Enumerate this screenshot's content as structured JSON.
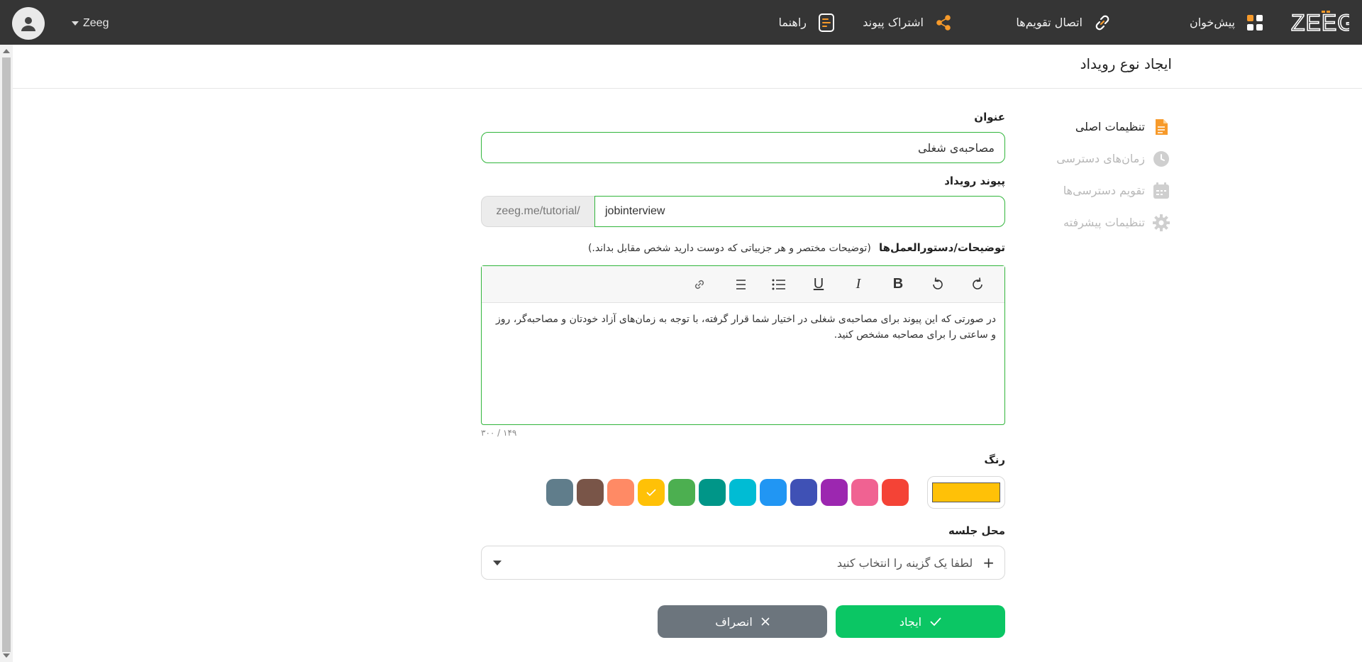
{
  "topbar": {
    "logo_text": "ZEEG",
    "nav": [
      {
        "label": "پیش‌خوان",
        "icon": "dashboard-grid-icon"
      },
      {
        "label": "اتصال تقویم‌ها",
        "icon": "link-icon"
      },
      {
        "label": "اشتراک پیوند",
        "icon": "share-icon"
      },
      {
        "label": "راهنما",
        "icon": "help-doc-icon"
      }
    ],
    "user_name": "Zeeg",
    "accent": "#f79a2a"
  },
  "page": {
    "title": "ایجاد نوع رویداد"
  },
  "steps": [
    {
      "label": "تنظیمات اصلی",
      "icon": "document-icon",
      "active": true
    },
    {
      "label": "زمان‌های دسترسی",
      "icon": "clock-icon",
      "active": false
    },
    {
      "label": "تقویم دسترسی‌ها",
      "icon": "calendar-icon",
      "active": false
    },
    {
      "label": "تنظیمات پیشرفته",
      "icon": "gear-icon",
      "active": false
    }
  ],
  "form": {
    "title_label": "عنوان",
    "title_value": "مصاحبه‌ی شغلی",
    "link_label": "پیوند رویداد",
    "link_prefix": "zeeg.me/tutorial/",
    "link_value": "jobinterview",
    "desc_label": "توضیحات/دستورالعمل‌ها",
    "desc_hint": "(توضیحات مختصر و هر جزییاتی که دوست دارید شخص مقابل بداند.)",
    "desc_value": "در صورتی که این پیوند برای مصاحبه‌ی شغلی در اختیار شما قرار گرفته، با توجه به زمان‌های آزاد خودتان و مصاحبه‌گر، روز و ساعتی را برای مصاحبه مشخص کنید.",
    "desc_counter": "۳۰۰ / ۱۴۹",
    "toolbar": [
      "redo",
      "undo",
      "bold",
      "italic",
      "underline",
      "bullet-list",
      "numbered-list",
      "link"
    ],
    "color_label": "رنگ",
    "selected_color": "#ffc107",
    "swatches": [
      "#f44336",
      "#f06292",
      "#9c27b0",
      "#3f51b5",
      "#2196f3",
      "#00bcd4",
      "#009688",
      "#4caf50",
      "#ffc107",
      "#ff8a65",
      "#795548",
      "#607d8b"
    ],
    "location_label": "محل جلسه",
    "location_placeholder": "لطفا یک گزینه را انتخاب کنید",
    "create_label": "ایجاد",
    "cancel_label": "انصراف"
  }
}
